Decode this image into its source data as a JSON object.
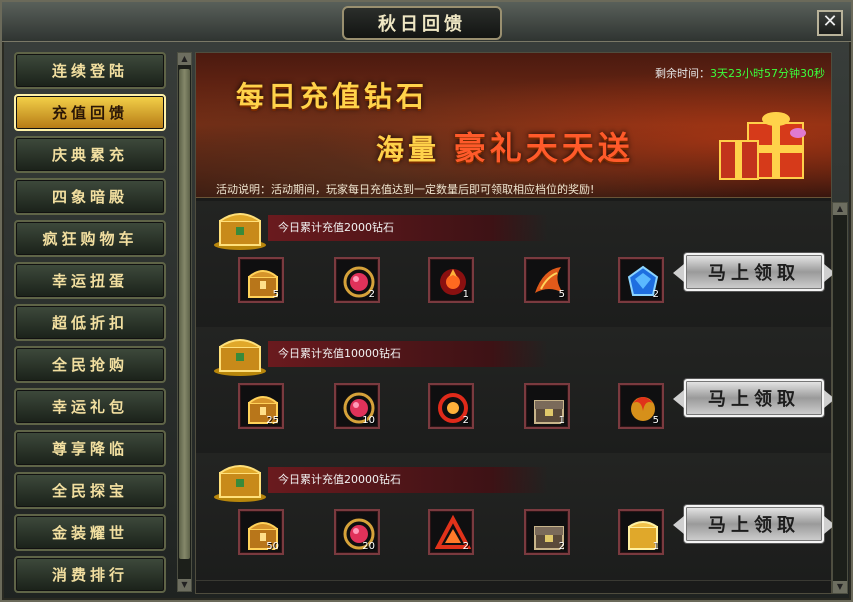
{
  "window": {
    "title": "秋日回馈",
    "close_label": "✕"
  },
  "sidebar": {
    "items": [
      {
        "label": "连续登陆",
        "active": false
      },
      {
        "label": "充值回馈",
        "active": true
      },
      {
        "label": "庆典累充",
        "active": false
      },
      {
        "label": "四象暗殿",
        "active": false
      },
      {
        "label": "疯狂购物车",
        "active": false
      },
      {
        "label": "幸运扭蛋",
        "active": false
      },
      {
        "label": "超低折扣",
        "active": false
      },
      {
        "label": "全民抢购",
        "active": false
      },
      {
        "label": "幸运礼包",
        "active": false
      },
      {
        "label": "尊享降临",
        "active": false
      },
      {
        "label": "全民探宝",
        "active": false
      },
      {
        "label": "金装耀世",
        "active": false
      },
      {
        "label": "消费排行",
        "active": false
      }
    ]
  },
  "banner": {
    "line1": "每日充值钻石",
    "line2_a": "海量",
    "line2_b": "豪礼天天送",
    "timer_label": "剩余时间：",
    "timer_value": "3天23小时57分钟30秒",
    "desc_label": "活动说明：",
    "desc_text": "活动期间，玩家每日充值达到一定数量后即可领取相应档位的奖励!"
  },
  "tiers": [
    {
      "label": "今日累计充值2000钻石",
      "button": "马上领取",
      "items": [
        {
          "icon": "treasure-chest-icon",
          "count": "5"
        },
        {
          "icon": "red-gem-icon",
          "count": "2"
        },
        {
          "icon": "fire-orb-icon",
          "count": "1"
        },
        {
          "icon": "flame-wing-icon",
          "count": "5"
        },
        {
          "icon": "blue-gem-icon",
          "count": "2"
        }
      ]
    },
    {
      "label": "今日累计充值10000钻石",
      "button": "马上领取",
      "items": [
        {
          "icon": "treasure-chest-icon",
          "count": "25"
        },
        {
          "icon": "red-gem-icon",
          "count": "10"
        },
        {
          "icon": "fire-ring-icon",
          "count": "2"
        },
        {
          "icon": "dark-chest-icon",
          "count": "1"
        },
        {
          "icon": "gold-dragon-icon",
          "count": "5"
        }
      ]
    },
    {
      "label": "今日累计充值20000钻石",
      "button": "马上领取",
      "items": [
        {
          "icon": "treasure-chest-icon",
          "count": "50"
        },
        {
          "icon": "red-gem-icon",
          "count": "20"
        },
        {
          "icon": "red-triangle-icon",
          "count": "2"
        },
        {
          "icon": "dark-chest-icon",
          "count": "2"
        },
        {
          "icon": "gold-chest-icon",
          "count": "1"
        }
      ]
    }
  ],
  "colors": {
    "accent_gold": "#f4d24a",
    "timer_green": "#3cff3c",
    "tier_label_bg": "#6a1a1e"
  }
}
